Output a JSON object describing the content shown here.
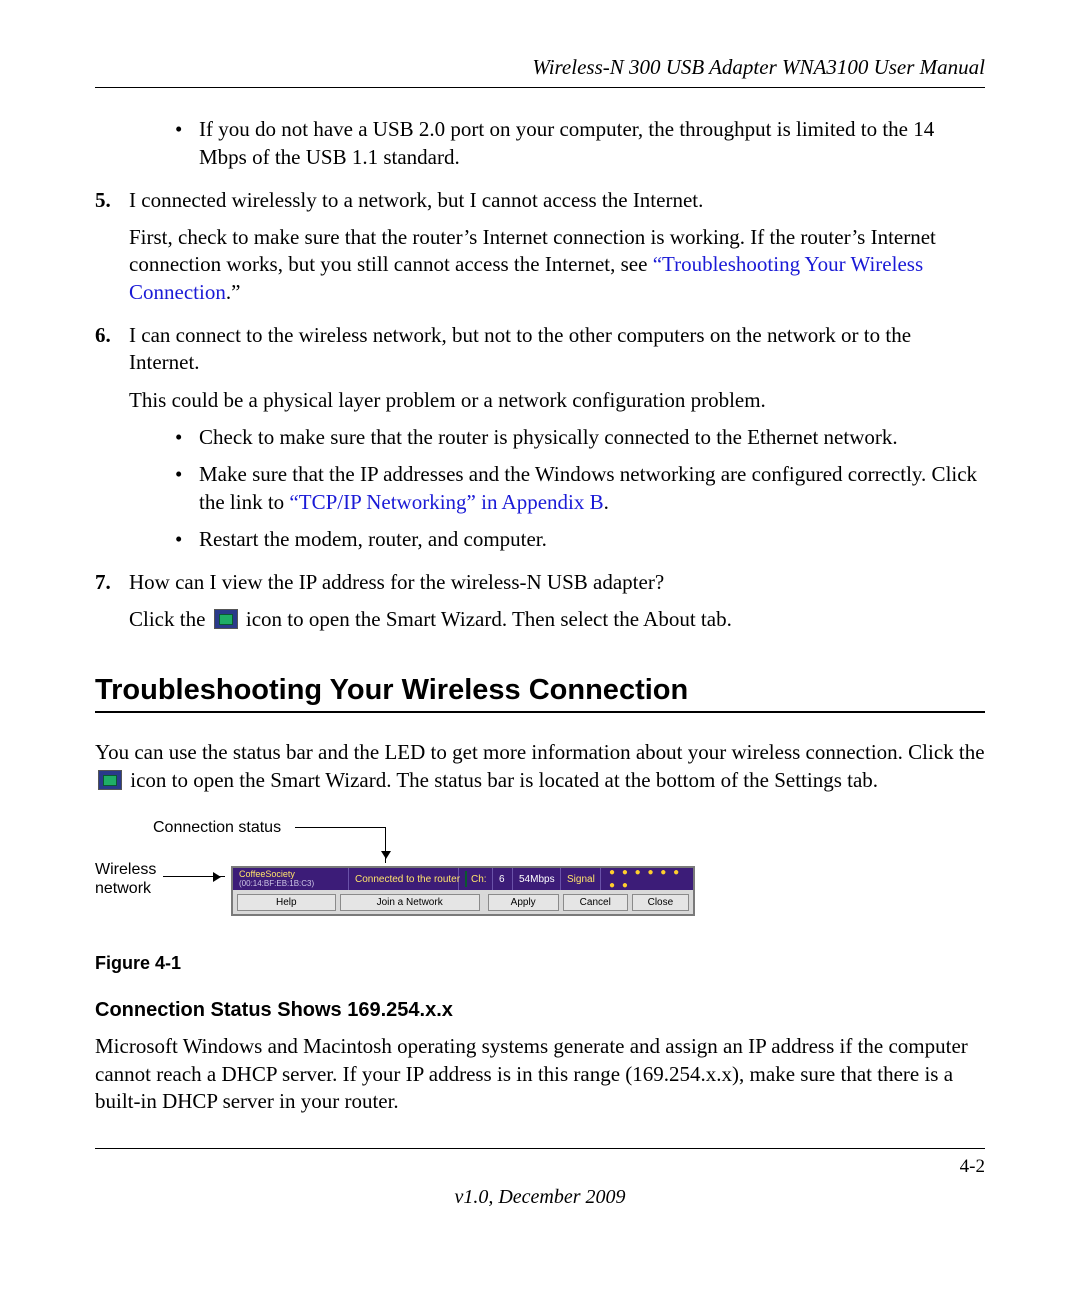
{
  "header": {
    "title": "Wireless-N 300 USB Adapter WNA3100 User Manual"
  },
  "bullet_usb": "If you do not have a USB 2.0 port on your computer, the throughput is limited to the 14 Mbps of the USB 1.1 standard.",
  "item5": {
    "num": "5.",
    "q": "I connected wirelessly to a network, but I cannot access the Internet.",
    "p1a": "First, check to make sure that the router’s Internet connection is working. If the router’s Internet connection works, but you still cannot access the Internet, see ",
    "link": "“Troubleshooting Your Wireless Connection",
    "p1b": ".”"
  },
  "item6": {
    "num": "6.",
    "q": "I can connect to the wireless network, but not to the other computers on the network or to the Internet.",
    "p1": "This could be a physical layer problem or a network configuration problem.",
    "b1": "Check to make sure that the router is physically connected to the Ethernet network.",
    "b2a": "Make sure that the IP addresses and the Windows networking are configured correctly. Click the link to ",
    "b2link": "“TCP/IP Networking” in Appendix B",
    "b2b": ".",
    "b3": "Restart the modem, router, and computer."
  },
  "item7": {
    "num": "7.",
    "q": "How can I view the IP address for the wireless-N USB adapter?",
    "p1a": "Click the ",
    "p1b": " icon to open the Smart Wizard. Then select the About tab."
  },
  "section_title": "Troubleshooting Your Wireless Connection",
  "section_p1a": "You can use the status bar and the LED to get more information about your wireless connection. Click the ",
  "section_p1b": " icon to open the Smart Wizard. The status bar is located at the bottom of the Settings tab.",
  "figure": {
    "label_connection_status": "Connection status",
    "label_wireless_network": "Wireless\nnetwork",
    "caption": "Figure 4-1",
    "statusbar": {
      "network_name": "CoffeeSociety",
      "network_mac": "(00:14:BF:EB:1B:C3)",
      "status": "Connected to the router",
      "ch_label": "Ch:",
      "ch_value": "6",
      "rate": "54Mbps",
      "signal_label": "Signal",
      "signal_dots": "● ● ● ● ● ● ● ●",
      "help": "Help",
      "join": "Join a Network",
      "apply": "Apply",
      "cancel": "Cancel",
      "close": "Close"
    }
  },
  "subsection_title": "Connection Status Shows 169.254.x.x",
  "subsection_p": "Microsoft Windows and Macintosh operating systems generate and assign an IP address if the computer cannot reach a DHCP server. If your IP address is in this range (169.254.x.x), make sure that there is a built-in DHCP server in your router.",
  "footer": {
    "page": "4-2",
    "version": "v1.0, December 2009"
  }
}
